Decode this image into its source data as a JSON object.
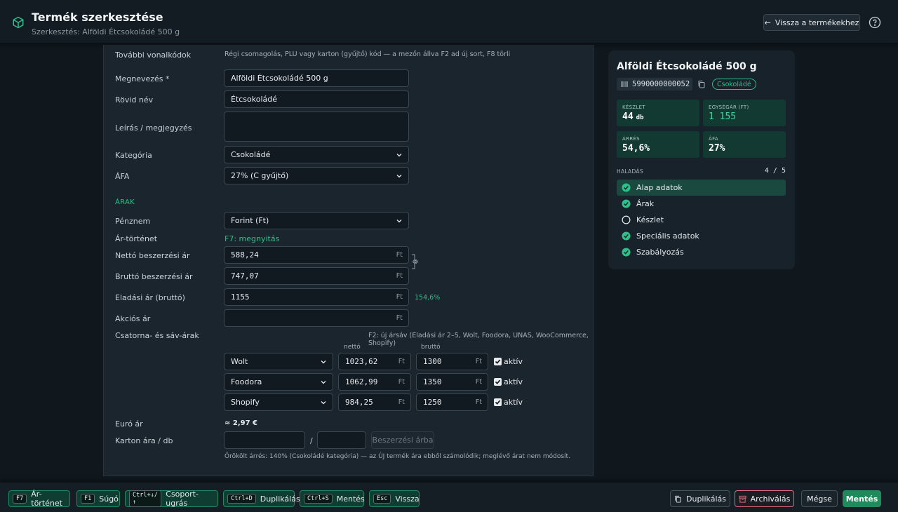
{
  "header": {
    "title": "Termék szerkesztése",
    "subtitle": "Szerkesztés: Alföldi Étcsokoládé 500 g",
    "back_label": "Vissza a termékekhez"
  },
  "form": {
    "barcodes": {
      "label": "További vonalkódok",
      "hint": "Régi csomagolás, PLU vagy karton (gyűjtő) kód — a mezőn állva F2 ad új sort, F8 törli"
    },
    "name": {
      "label": "Megnevezés *",
      "value": "Alföldi Étcsokoládé 500 g"
    },
    "short_name": {
      "label": "Rövid név",
      "value": "Étcsokoládé"
    },
    "description": {
      "label": "Leírás / megjegyzés",
      "value": ""
    },
    "category": {
      "label": "Kategória",
      "value": "Csokoládé"
    },
    "vat": {
      "label": "ÁFA",
      "value": "27% (C gyűjtő)"
    },
    "prices_section": "ÁRAK",
    "currency": {
      "label": "Pénznem",
      "value": "Forint (Ft)"
    },
    "price_history": {
      "label": "Ár-történet",
      "link": "F7: megnyitás"
    },
    "net_purchase": {
      "label": "Nettó beszerzési ár",
      "value": "588,24",
      "unit": "Ft"
    },
    "gross_purchase": {
      "label": "Bruttó beszerzési ár",
      "value": "747,07",
      "unit": "Ft"
    },
    "sale_price": {
      "label": "Eladási ár (bruttó)",
      "value": "1155",
      "unit": "Ft",
      "margin": "154,6%"
    },
    "promo_price": {
      "label": "Akciós ár",
      "value": "",
      "unit": "Ft"
    },
    "channels": {
      "label": "Csatorna- és sáv-árak",
      "hint": "F2: új ársáv (Eladási ár 2–5, Wolt, Foodora, UNAS, WooCommerce, Shopify)",
      "net_header": "nettó",
      "gross_header": "bruttó",
      "unit": "Ft",
      "active_label": "aktív",
      "rows": [
        {
          "channel": "Wolt",
          "net": "1023,62",
          "gross": "1300",
          "active": true
        },
        {
          "channel": "Foodora",
          "net": "1062,99",
          "gross": "1350",
          "active": true
        },
        {
          "channel": "Shopify",
          "net": "984,25",
          "gross": "1250",
          "active": true
        }
      ]
    },
    "euro": {
      "label": "Euró ár",
      "value": "≈ 2,97 €"
    },
    "carton": {
      "label": "Karton ára / db",
      "value1": "",
      "separator": "/",
      "value2": "",
      "button": "Beszerzési árba"
    },
    "inherited_note": "Örökölt árrés: 140% (Csokoládé kategória) — az ÚJ termék ára ebből számolódik; meglévő árat nem módosít."
  },
  "summary": {
    "name": "Alföldi Étcsokoládé 500 g",
    "barcode": "5990000000052",
    "category_badge": "Csokoládé",
    "stats": [
      {
        "key": "KÉSZLET",
        "value": "44",
        "unit": "db"
      },
      {
        "key": "EGYSÉGÁR (FT)",
        "value": "1 155"
      },
      {
        "key": "ÁRRÉS",
        "value": "54,6%"
      },
      {
        "key": "ÁFA",
        "value": "27%"
      }
    ],
    "progress_label": "HALADÁS",
    "progress_count": "4 / 5",
    "steps": [
      {
        "label": "Alap adatok",
        "done": true
      },
      {
        "label": "Árak",
        "done": true
      },
      {
        "label": "Készlet",
        "done": false
      },
      {
        "label": "Speciális adatok",
        "done": true
      },
      {
        "label": "Szabályozás",
        "done": true
      }
    ]
  },
  "shortcuts": [
    {
      "key": "F7",
      "label": "Ár-történet"
    },
    {
      "key": "F1",
      "label": "Súgó"
    },
    {
      "key": "Ctrl+↓/↑",
      "label": "Csoport-ugrás"
    },
    {
      "key": "Ctrl+D",
      "label": "Duplikálás"
    },
    {
      "key": "Ctrl+S",
      "label": "Mentés"
    },
    {
      "key": "Esc",
      "label": "Vissza"
    }
  ],
  "actions": {
    "duplicate": "Duplikálás",
    "archive": "Archiválás",
    "cancel": "Mégse",
    "save": "Mentés"
  },
  "colors": {
    "accent": "#2fbf8a",
    "stat_bg": "#123a33",
    "save_bg": "#1f8a5c",
    "archive_border": "#e06b7a"
  }
}
